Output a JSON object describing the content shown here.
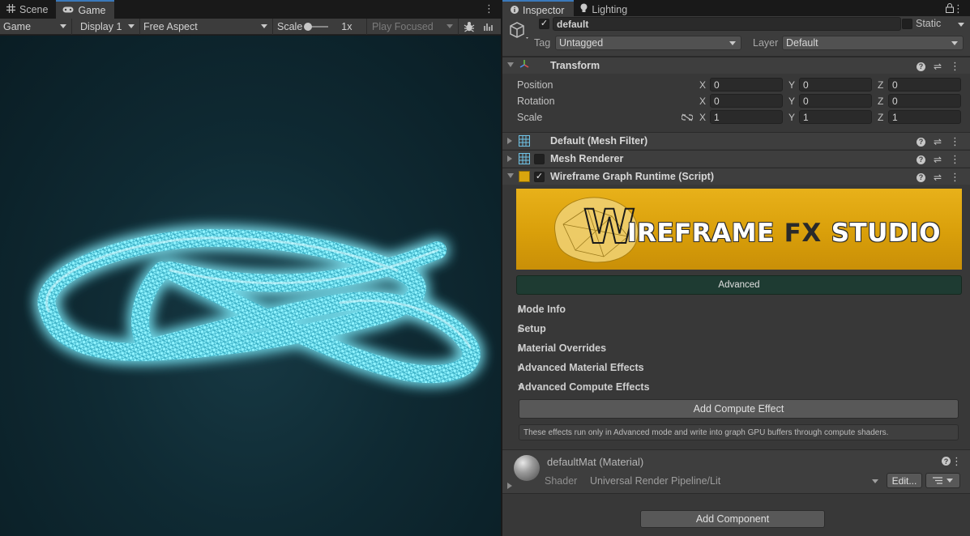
{
  "game_window": {
    "tabs": [
      {
        "label": "Scene",
        "icon": "grid-icon"
      },
      {
        "label": "Game",
        "icon": "gamepad-icon"
      }
    ],
    "toolbar": {
      "display_mode": "Game",
      "display": "Display 1",
      "aspect": "Free Aspect",
      "scale_label": "Scale",
      "scale_value": 0.0,
      "scale_text": "1x",
      "play_mode": "Play Focused"
    }
  },
  "inspector": {
    "tabs": [
      {
        "label": "Inspector",
        "icon": "info-icon"
      },
      {
        "label": "Lighting",
        "icon": "bulb-icon"
      }
    ],
    "object": {
      "name": "default",
      "active": true,
      "static_label": "Static",
      "tag_label": "Tag",
      "tag_value": "Untagged",
      "layer_label": "Layer",
      "layer_value": "Default"
    },
    "transform": {
      "title": "Transform",
      "rows": [
        {
          "label": "Position",
          "x": "0",
          "y": "0",
          "z": "0"
        },
        {
          "label": "Rotation",
          "x": "0",
          "y": "0",
          "z": "0"
        },
        {
          "label": "Scale",
          "x": "1",
          "y": "1",
          "z": "1"
        }
      ],
      "axis_labels": [
        "X",
        "Y",
        "Z"
      ]
    },
    "components": [
      {
        "title": "Default (Mesh Filter)",
        "icon": "mesh-filter-icon"
      },
      {
        "title": "Mesh Renderer",
        "icon": "mesh-renderer-icon"
      },
      {
        "title": "Wireframe Graph Runtime (Script)",
        "icon": "script-icon"
      }
    ],
    "wireframe_script": {
      "banner_letter": "W",
      "banner_text_1": "IREFRAME",
      "banner_text_2": "FX",
      "banner_text_3": "STUDIO",
      "mode_button": "Advanced",
      "sections": [
        {
          "label": "Mode Info",
          "open": false
        },
        {
          "label": "Setup",
          "open": false
        },
        {
          "label": "Material Overrides",
          "open": false
        },
        {
          "label": "Advanced Material Effects",
          "open": false
        },
        {
          "label": "Advanced Compute Effects",
          "open": true
        }
      ],
      "add_compute_button": "Add Compute Effect",
      "compute_help": "These effects run only in Advanced mode and write into graph GPU buffers through compute shaders."
    },
    "material": {
      "name": "defaultMat (Material)",
      "shader_label": "Shader",
      "shader_value": "Universal Render Pipeline/Lit",
      "edit_button": "Edit..."
    },
    "add_component_button": "Add Component"
  },
  "colors": {
    "accent": "#3a79bb",
    "banner_yellow": "#e0a70e",
    "advanced_button": "#1e3b32",
    "glow_cyan": "#7ff0ff"
  }
}
